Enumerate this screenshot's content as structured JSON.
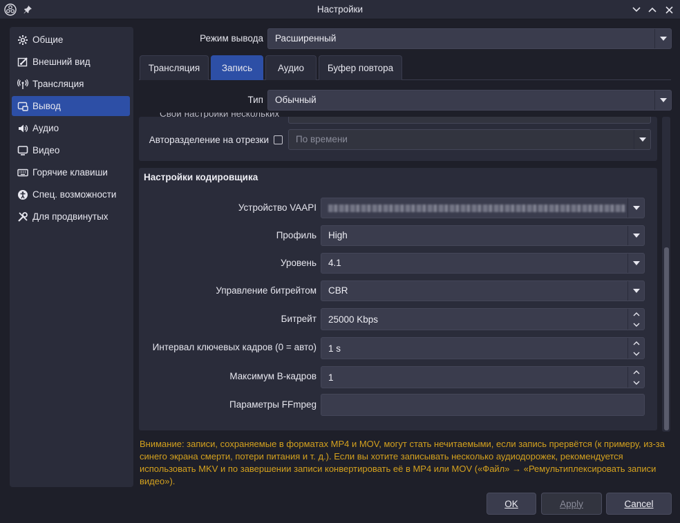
{
  "window": {
    "title": "Настройки"
  },
  "sidebar": {
    "items": [
      {
        "label": "Общие",
        "icon": "gear-icon"
      },
      {
        "label": "Внешний вид",
        "icon": "appearance-icon"
      },
      {
        "label": "Трансляция",
        "icon": "broadcast-icon"
      },
      {
        "label": "Вывод",
        "icon": "output-icon",
        "active": true
      },
      {
        "label": "Аудио",
        "icon": "speaker-icon"
      },
      {
        "label": "Видео",
        "icon": "monitor-icon"
      },
      {
        "label": "Горячие клавиши",
        "icon": "keyboard-icon"
      },
      {
        "label": "Спец. возможности",
        "icon": "accessibility-icon"
      },
      {
        "label": "Для продвинутых",
        "icon": "tools-icon"
      }
    ]
  },
  "output_mode": {
    "label": "Режим вывода",
    "value": "Расширенный"
  },
  "tabs": [
    {
      "label": "Трансляция"
    },
    {
      "label": "Запись",
      "active": true
    },
    {
      "label": "Аудио"
    },
    {
      "label": "Буфер повтора"
    }
  ],
  "type": {
    "label": "Тип",
    "value": "Обычный"
  },
  "split": {
    "cut_label": "Свои настройки нескольких",
    "label": "Авторазделение на отрезки",
    "checked": false,
    "value": "По времени"
  },
  "encoder": {
    "title": "Настройки кодировщика",
    "device_label": "Устройство VAAPI",
    "profile_label": "Профиль",
    "profile_value": "High",
    "level_label": "Уровень",
    "level_value": "4.1",
    "rate_control_label": "Управление битрейтом",
    "rate_control_value": "CBR",
    "bitrate_label": "Битрейт",
    "bitrate_value": "25000 Kbps",
    "keyint_label": "Интервал ключевых кадров (0 = авто)",
    "keyint_value": "1 s",
    "bframes_label": "Максимум B-кадров",
    "bframes_value": "1",
    "ffmpeg_label": "Параметры FFmpeg",
    "ffmpeg_value": ""
  },
  "warning": "Внимание: записи, сохраняемые в форматах MP4 и MOV, могут стать нечитаемыми, если запись прервётся (к примеру, из-за синего экрана смерти, потери питания и т. д.). Если вы хотите записывать несколько аудиодорожек, рекомендуется использовать MKV и по завершении записи конвертировать её в MP4 или MOV («Файл» → «Ремультиплексировать записи видео»).",
  "buttons": {
    "ok": "OK",
    "apply": "Apply",
    "cancel": "Cancel"
  },
  "colors": {
    "accent": "#2d4fa6",
    "warning": "#d4a11e",
    "background": "#1e1f29"
  }
}
